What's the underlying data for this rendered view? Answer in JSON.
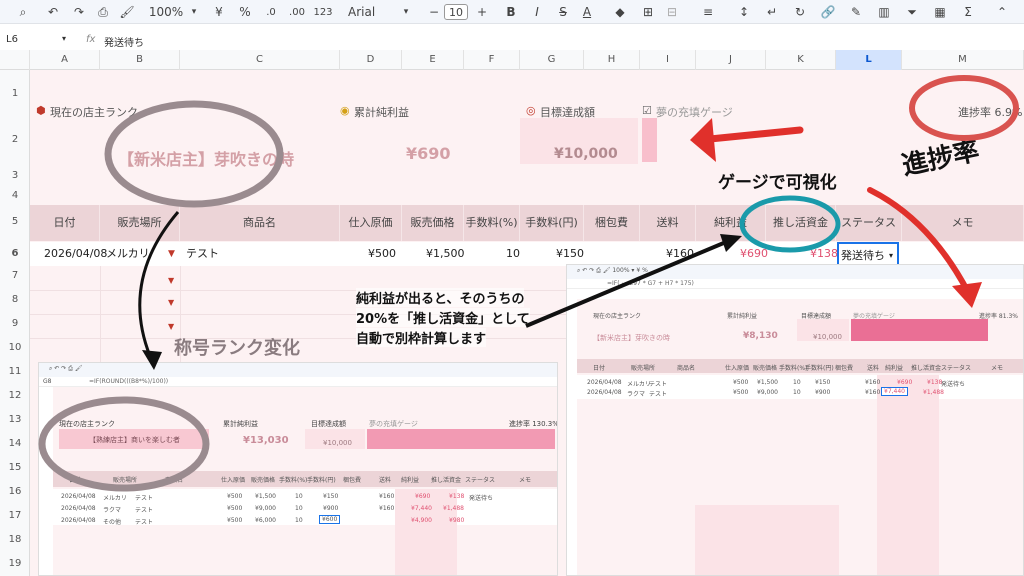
{
  "toolbar": {
    "zoom": "100%",
    "currency": "¥",
    "percent": "%",
    "dec_dec": ".0",
    "dec_inc": ".00",
    "number_fmt": "123",
    "font": "Arial",
    "font_size": "10",
    "minus": "−",
    "plus": "+",
    "bold": "B",
    "italic": "I",
    "strike": "S",
    "text_color": "A"
  },
  "formula_bar": {
    "cell": "L6",
    "fx": "fx",
    "value": "発送待ち"
  },
  "columns": [
    "A",
    "B",
    "C",
    "D",
    "E",
    "F",
    "G",
    "H",
    "I",
    "J",
    "K",
    "L",
    "M"
  ],
  "rows": [
    "1",
    "2",
    "3",
    "4",
    "5",
    "6",
    "7",
    "8",
    "9",
    "10",
    "11",
    "12",
    "13",
    "14",
    "15",
    "16",
    "17",
    "18",
    "19"
  ],
  "top": {
    "rank_label": "現在の店主ランク",
    "rank_value": "【新米店主】芽吹きの時",
    "profit_label": "累計純利益",
    "profit_value": "¥690",
    "goal_label": "目標達成額",
    "goal_value": "¥10,000",
    "gauge_label": "夢の充填ゲージ",
    "progress_text": "進捗率 6.9%",
    "progress_fraction": 0.069
  },
  "headers": [
    "日付",
    "販売場所",
    "商品名",
    "仕入原価",
    "販売価格",
    "手数料(%)",
    "手数料(円)",
    "梱包費",
    "送料",
    "純利益",
    "推し活資金",
    "ステータス",
    "メモ"
  ],
  "row6": {
    "date": "2026/04/08",
    "place": "メルカリ",
    "item": "テスト",
    "cost": "¥500",
    "price": "¥1,500",
    "fee_pct": "10",
    "fee_yen": "¥150",
    "shipping": "¥160",
    "profit": "¥690",
    "oshi": "¥138",
    "status": "発送待ち"
  },
  "annotations": {
    "gauge": "ゲージで可視化",
    "progress": "進捗率",
    "rank_change": "称号ランク変化",
    "note_line1": "純利益が出ると、そのうちの",
    "note_line2": "20%を「推し活資金」として",
    "note_line3": "自動で別枠計算します"
  },
  "mini_left": {
    "cell": "G8",
    "formula": "=IF(ROUND(((B8*%)/100))",
    "rank_label": "現在の店主ランク",
    "rank_value": "【熟練店主】商いを楽しむ者",
    "profit_label": "累計純利益",
    "profit_value": "¥13,030",
    "goal_label": "目標達成額",
    "goal_value": "¥10,000",
    "gauge_label": "夢の充填ゲージ",
    "progress_text": "進捗率 130.3%",
    "progress_fraction": 1.303,
    "headers": [
      "日付",
      "販売場所",
      "商品名",
      "仕入原価",
      "販売価格",
      "手数料(%)",
      "手数料(円)",
      "梱包費",
      "送料",
      "純利益",
      "推し活資金",
      "ステータス",
      "メモ"
    ],
    "rows": [
      [
        "2026/04/08",
        "メルカリ",
        "テスト",
        "¥500",
        "¥1,500",
        "10",
        "¥150",
        "",
        "¥160",
        "¥690",
        "¥138",
        "発送待ち"
      ],
      [
        "2026/04/08",
        "ラクマ",
        "テスト",
        "¥500",
        "¥9,000",
        "10",
        "¥900",
        "",
        "¥160",
        "¥7,440",
        "¥1,488",
        ""
      ],
      [
        "2026/04/08",
        "その他",
        "テスト",
        "¥500",
        "¥6,000",
        "10",
        "¥600",
        "",
        "",
        "¥4,900",
        "¥980",
        ""
      ]
    ],
    "row_numbers": [
      "2",
      "3",
      "4",
      "5",
      "6",
      "7",
      "8",
      "9",
      "10",
      "11"
    ]
  },
  "mini_right": {
    "formula": "=IF( ⋯ E97 * G7 + H7 * 175)",
    "rank_label": "現在の店主ランク",
    "rank_value": "【新米店主】芽吹きの時",
    "profit_label": "累計純利益",
    "profit_value": "¥8,130",
    "goal_label": "目標達成額",
    "goal_value": "¥10,000",
    "gauge_label": "夢の充填ゲージ",
    "progress_text": "進捗率 81.3%",
    "progress_fraction": 0.813,
    "headers": [
      "日付",
      "販売場所",
      "商品名",
      "仕入原価",
      "販売価格",
      "手数料(%)",
      "手数料(円)",
      "梱包費",
      "送料",
      "純利益",
      "推し活資金",
      "ステータス",
      "メモ"
    ],
    "rows": [
      [
        "2026/04/08",
        "メルカリ",
        "テスト",
        "¥500",
        "¥1,500",
        "10",
        "¥150",
        "",
        "¥160",
        "¥690",
        "¥138",
        "発送待ち"
      ],
      [
        "2026/04/08",
        "ラクマ",
        "テスト",
        "¥500",
        "¥9,000",
        "10",
        "¥900",
        "",
        "¥160",
        "¥7,440",
        "¥1,488",
        ""
      ]
    ]
  },
  "colors": {
    "sheet_bg": "#fdf2f3",
    "header_bg": "#ecd4d7",
    "pink_cell": "#f8c8d2",
    "gauge_fill": "#ea6f95",
    "circle_gray": "#9a8b8f",
    "circle_red": "#d9534f",
    "circle_teal": "#1a9aaa",
    "arrow_red": "#e0302b"
  }
}
